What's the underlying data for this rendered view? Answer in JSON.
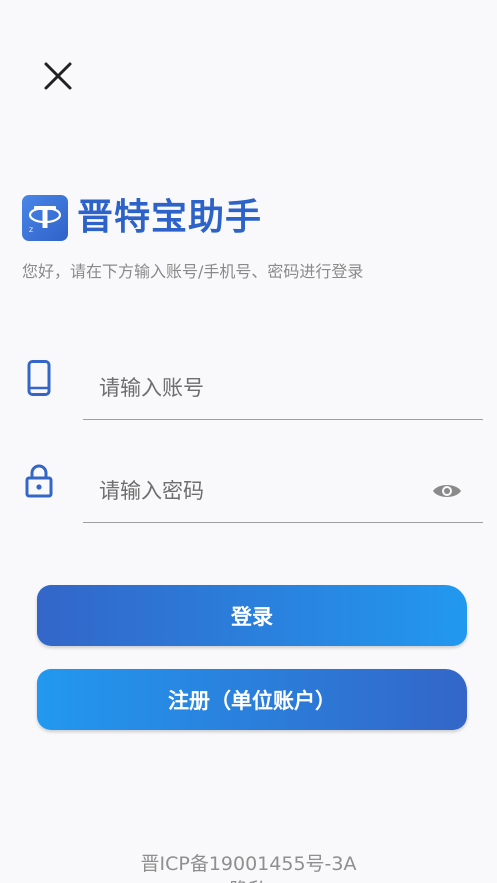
{
  "app": {
    "name": "晋特宝助手",
    "subtitle": "您好，请在下方输入账号/手机号、密码进行登录"
  },
  "form": {
    "account": {
      "placeholder": "请输入账号",
      "value": ""
    },
    "password": {
      "placeholder": "请输入密码",
      "value": ""
    }
  },
  "buttons": {
    "login_label": "登录",
    "register_label": "注册（单位账户）"
  },
  "footer": {
    "icp": "晋ICP备19001455号-3A",
    "second_line": "隐私"
  },
  "icons": {
    "close": "close-icon",
    "logo": "app-logo-icon",
    "phone": "phone-icon",
    "lock": "lock-icon",
    "eye": "eye-icon"
  },
  "colors": {
    "brand": "#2d63c8",
    "accent": "#2298ef",
    "icon": "#3466c7",
    "background": "#f9f9fb"
  }
}
